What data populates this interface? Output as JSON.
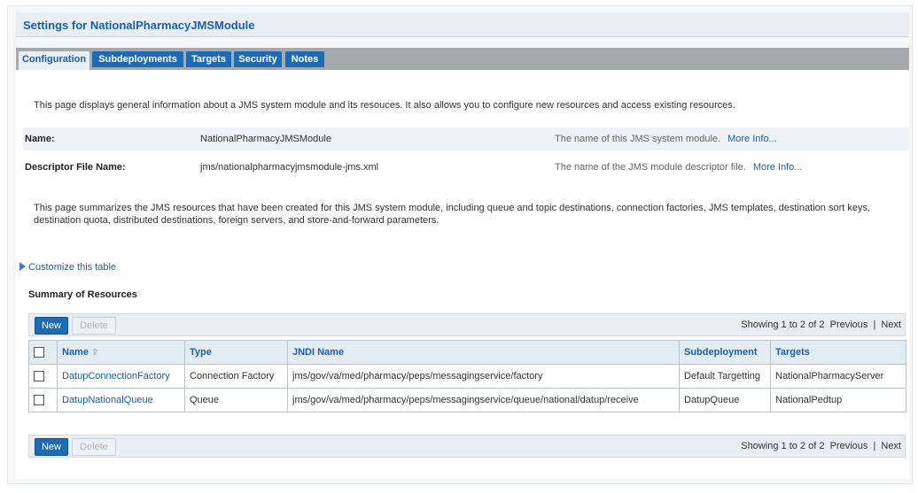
{
  "page": {
    "title": "Settings for NationalPharmacyJMSModule"
  },
  "tabs": [
    {
      "label": "Configuration",
      "active": true
    },
    {
      "label": "Subdeployments",
      "active": false
    },
    {
      "label": "Targets",
      "active": false
    },
    {
      "label": "Security",
      "active": false
    },
    {
      "label": "Notes",
      "active": false
    }
  ],
  "intro": "This page displays general information about a JMS system module and its resouces. It also allows you to configure new resources and access existing resources.",
  "info": [
    {
      "key": "Name:",
      "value": "NationalPharmacyJMSModule",
      "desc": "The name of this JMS system module.",
      "more": "More Info..."
    },
    {
      "key": "Descriptor File Name:",
      "value": "jms/nationalpharmacyjmsmodule-jms.xml",
      "desc": "The name of the JMS module descriptor file.",
      "more": "More Info..."
    }
  ],
  "summary_text": "This page summarizes the JMS resources that have been created for this JMS system module, including queue and topic destinations, connection factories, JMS templates, destination sort keys, destination quota, distributed destinations, foreign servers, and store-and-forward parameters.",
  "customize_link": "Customize this table",
  "resources": {
    "title": "Summary of Resources",
    "new_label": "New",
    "delete_label": "Delete",
    "paging": {
      "showing": "Showing 1 to 2 of 2",
      "previous": "Previous",
      "separator": "|",
      "next": "Next"
    },
    "columns": [
      "Name",
      "Type",
      "JNDI Name",
      "Subdeployment",
      "Targets"
    ],
    "rows": [
      {
        "name": "DatupConnectionFactory",
        "type": "Connection Factory",
        "jndi": "jms/gov/va/med/pharmacy/peps/messagingservice/factory",
        "subdeployment": "Default Targetting",
        "targets": "NationalPharmacyServer"
      },
      {
        "name": "DatupNationalQueue",
        "type": "Queue",
        "jndi": "jms/gov/va/med/pharmacy/peps/messagingservice/queue/national/datup/receive",
        "subdeployment": "DatupQueue",
        "targets": "NationalPedtup"
      }
    ]
  },
  "colors": {
    "accent": "#1f6bb3",
    "title": "#1a5fa8",
    "tabbar": "#a7a9ac"
  }
}
